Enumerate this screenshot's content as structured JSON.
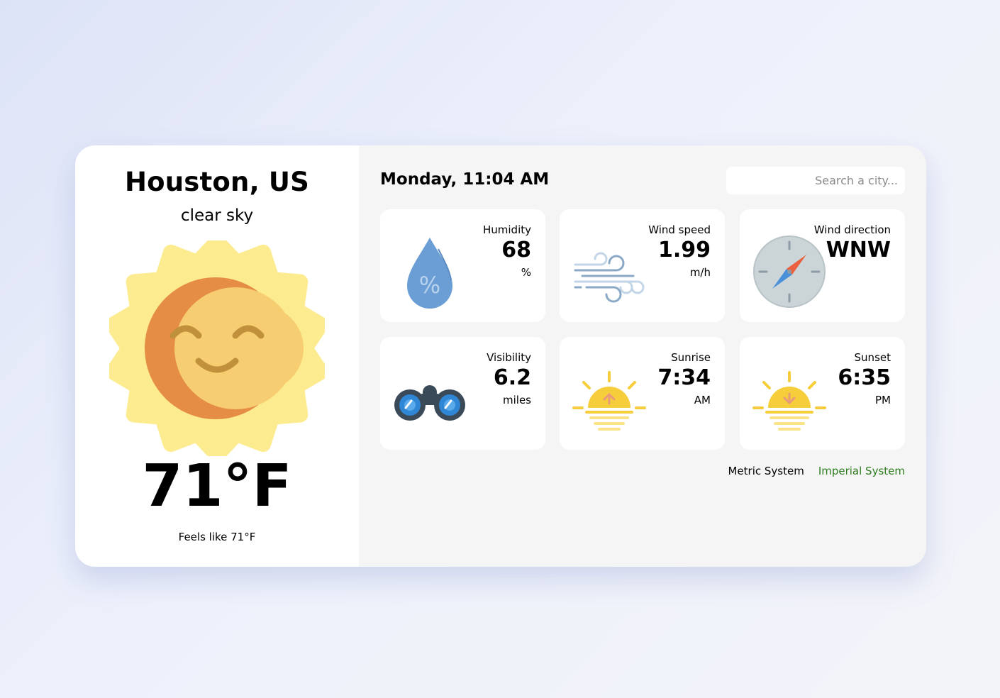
{
  "location": {
    "city": "Houston, US",
    "description": "clear sky",
    "temperature": "71°F",
    "feels_like": "Feels like 71°F",
    "weather_icon": "sun-icon"
  },
  "header": {
    "datetime": "Monday, 11:04 AM"
  },
  "search": {
    "placeholder": "Search a city..."
  },
  "cards": {
    "humidity": {
      "label": "Humidity",
      "value": "68",
      "unit": "%",
      "icon": "humidity-drop-icon"
    },
    "wind_speed": {
      "label": "Wind speed",
      "value": "1.99",
      "unit": "m/h",
      "icon": "wind-icon"
    },
    "wind_direction": {
      "label": "Wind direction",
      "value": "WNW",
      "icon": "compass-icon"
    },
    "visibility": {
      "label": "Visibility",
      "value": "6.2",
      "unit": "miles",
      "icon": "binoculars-icon"
    },
    "sunrise": {
      "label": "Sunrise",
      "value": "7:34",
      "unit": "AM",
      "icon": "sunrise-icon"
    },
    "sunset": {
      "label": "Sunset",
      "value": "6:35",
      "unit": "PM",
      "icon": "sunset-icon"
    }
  },
  "unit_system": {
    "metric_label": "Metric System",
    "imperial_label": "Imperial System",
    "selected": "imperial"
  },
  "colors": {
    "active_unit": "#2e7d1f",
    "sun_outer": "#fdeb8f",
    "sun_face": "#f6cd70",
    "sun_shadow": "#e58d45"
  }
}
